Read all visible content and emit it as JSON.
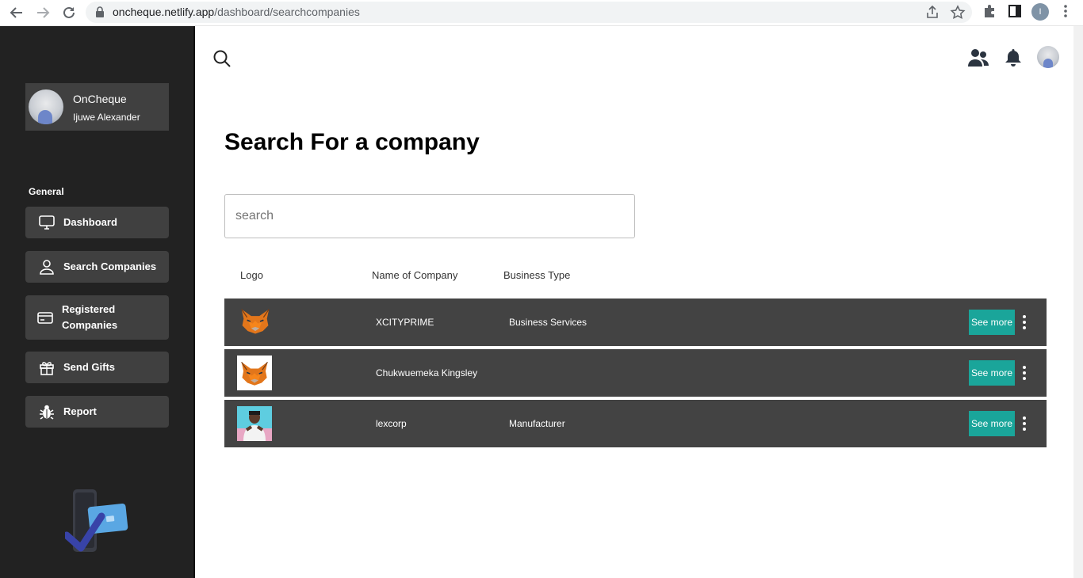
{
  "browser": {
    "url_host": "oncheque.netlify.app",
    "url_path": "/dashboard/searchcompanies",
    "profile_initial": "I"
  },
  "sidebar": {
    "org_name": "OnCheque",
    "user_name": "Ijuwe Alexander",
    "section_label": "General",
    "items": [
      {
        "label": "Dashboard",
        "icon": "monitor-icon"
      },
      {
        "label": "Search Companies",
        "icon": "user-icon"
      },
      {
        "label": "Registered Companies",
        "icon": "credit-card-icon"
      },
      {
        "label": "Send Gifts",
        "icon": "gift-icon"
      },
      {
        "label": "Report",
        "icon": "bug-icon"
      }
    ]
  },
  "header": {
    "icons": [
      "search-icon",
      "users-icon",
      "bell-icon",
      "avatar"
    ]
  },
  "main": {
    "title": "Search For a company",
    "search_placeholder": "search",
    "columns": [
      "Logo",
      "Name of Company",
      "Business Type"
    ],
    "rows": [
      {
        "name": "XCITYPRIME",
        "business_type": "Business Services",
        "action": "See more",
        "logo": "fox-logo"
      },
      {
        "name": "Chukwuemeka Kingsley",
        "business_type": "",
        "action": "See more",
        "logo": "fox-logo-white-bg"
      },
      {
        "name": "lexcorp",
        "business_type": "Manufacturer",
        "action": "See more",
        "logo": "person-photo"
      }
    ]
  },
  "colors": {
    "sidebar_bg": "#222222",
    "sidebar_item_bg": "#404040",
    "row_bg": "#434343",
    "accent": "#1aa59a"
  }
}
